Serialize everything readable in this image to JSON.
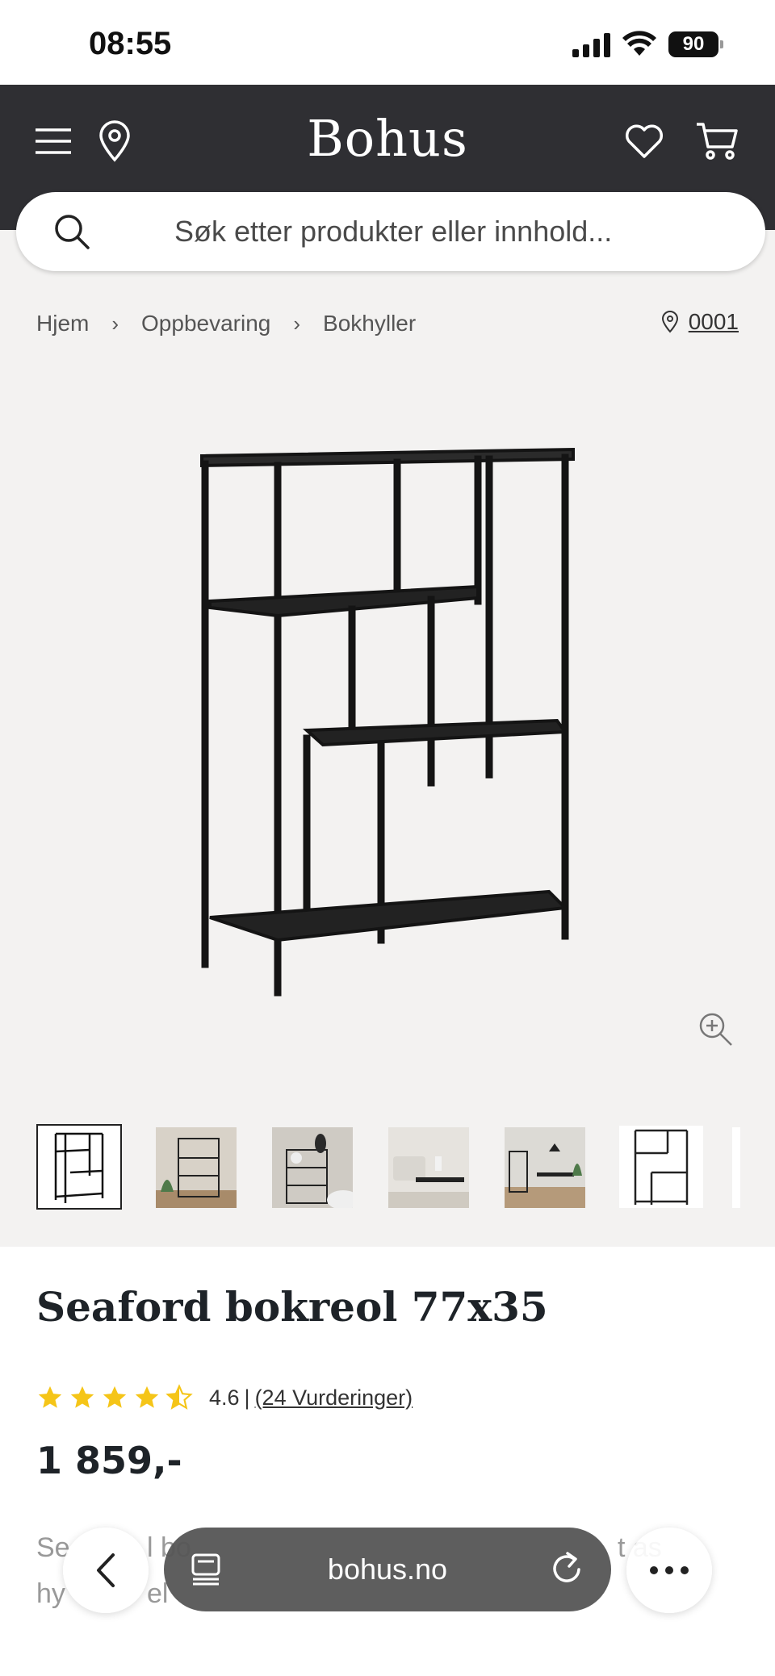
{
  "status": {
    "time": "08:55",
    "battery": "90"
  },
  "header": {
    "logo": "Bohus"
  },
  "search": {
    "placeholder": "Søk etter produkter eller innhold..."
  },
  "breadcrumb": {
    "items": [
      "Hjem",
      "Oppbevaring",
      "Bokhyller"
    ],
    "store": "0001"
  },
  "gallery": {
    "thumbnail_count": 7,
    "active_index": 0
  },
  "product": {
    "title": "Seaford bokreol 77x35",
    "rating_value": 4.5,
    "rating": "4.6",
    "reviews": "(24 Vurderinger)",
    "price": "1 859,-",
    "desc_start": "Se",
    "desc_mid": "l bo",
    "desc_end": "t as",
    "desc_line2_a": "hy",
    "desc_line2_b": "el"
  },
  "browser": {
    "url": "bohus.no"
  },
  "colors": {
    "header": "#2f2f33",
    "product_bg": "#f3f2f1",
    "star": "#f5c518",
    "text": "#1e2328"
  }
}
